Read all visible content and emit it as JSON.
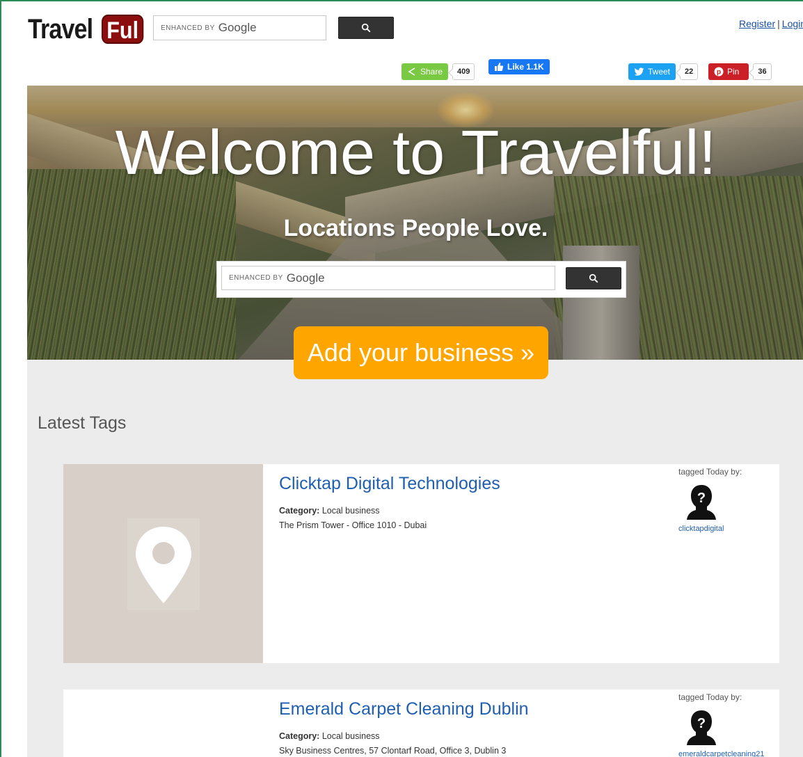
{
  "header": {
    "logo_part1": "Travel",
    "logo_part2": "Ful",
    "search_brand": "ENHANCED BY",
    "search_google": "Google",
    "register": "Register",
    "separator": "|",
    "login": "Login"
  },
  "social": {
    "share_label": "Share",
    "share_count": "409",
    "like_label": "Like 1.1K",
    "tweet_label": "Tweet",
    "tweet_count": "22",
    "pin_label": "Pin",
    "pin_count": "36",
    "colors": {
      "share": "#7ac943",
      "like": "#1877f2",
      "tweet": "#1da1f2",
      "pin": "#cb2027"
    }
  },
  "hero": {
    "title": "Welcome to Travelful!",
    "subtitle": "Locations People Love.",
    "search_brand": "ENHANCED BY",
    "search_google": "Google",
    "cta": "Add your business »",
    "cta_color": "#ffa500"
  },
  "latest": {
    "heading": "Latest Tags",
    "items": [
      {
        "title": "Clicktap Digital Technologies",
        "category_label": "Category:",
        "category_value": "Local business",
        "address": "The Prism Tower - Office 1010 - Dubai",
        "tagged_text": "tagged Today by:",
        "user": "clicktapdigital"
      },
      {
        "title": "Emerald Carpet Cleaning Dublin",
        "category_label": "Category:",
        "category_value": "Local business",
        "address": "Sky Business Centres, 57 Clontarf Road, Office 3, Dublin 3",
        "tagged_text": "tagged Today by:",
        "user": "emeraldcarpetcleaning21"
      }
    ]
  },
  "icons": [
    "search-icon",
    "share-icon",
    "thumbs-up-icon",
    "twitter-icon",
    "pinterest-icon",
    "map-pin-icon",
    "unknown-user-icon"
  ]
}
